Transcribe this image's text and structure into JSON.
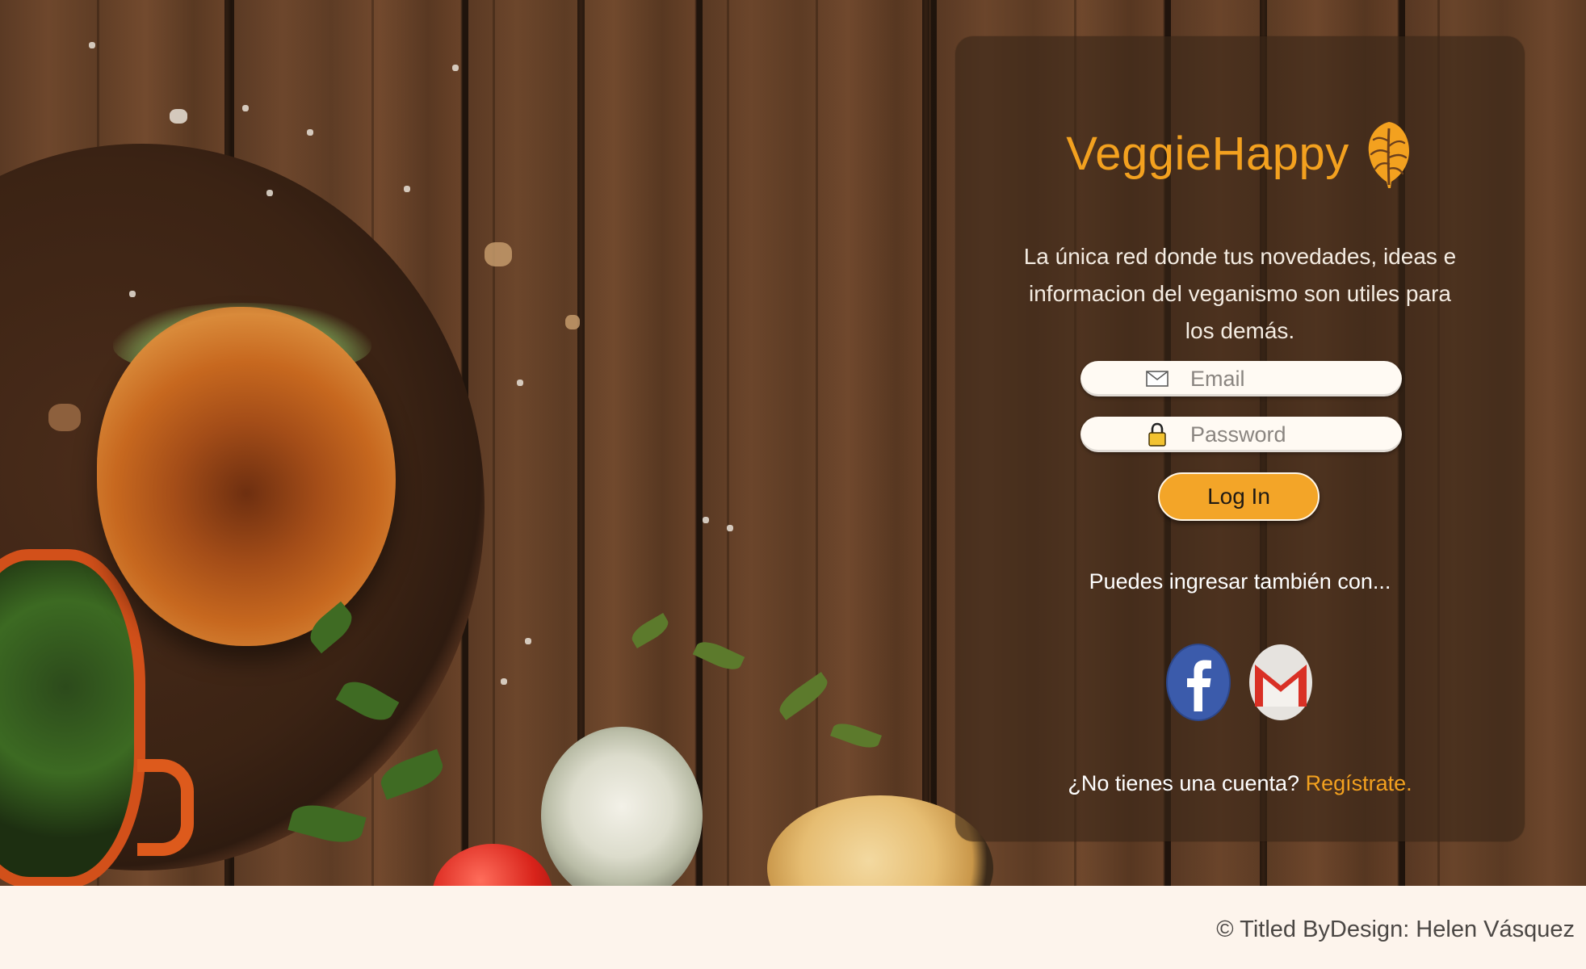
{
  "brand": {
    "name": "VeggieHappy",
    "logo_icon": "leaf-icon",
    "accent_color": "#f3a11f"
  },
  "tagline": "La única red donde tus novedades, ideas e informacion del veganismo son utiles para los demás.",
  "login": {
    "email": {
      "placeholder": "Email",
      "value": "",
      "icon": "envelope-icon"
    },
    "password": {
      "placeholder": "Password",
      "value": "",
      "icon": "lock-icon"
    },
    "submit_label": "Log In"
  },
  "social": {
    "prompt": "Puedes ingresar también con...",
    "providers": [
      {
        "name": "Facebook",
        "icon": "facebook-icon",
        "color": "#3b5bab"
      },
      {
        "name": "Gmail",
        "icon": "gmail-icon",
        "color": "#d93025"
      }
    ]
  },
  "signup": {
    "question": "¿No tienes una cuenta?",
    "link_label": "Regístrate."
  },
  "footer": {
    "credit": "© Titled ByDesign: Helen Vásquez"
  }
}
